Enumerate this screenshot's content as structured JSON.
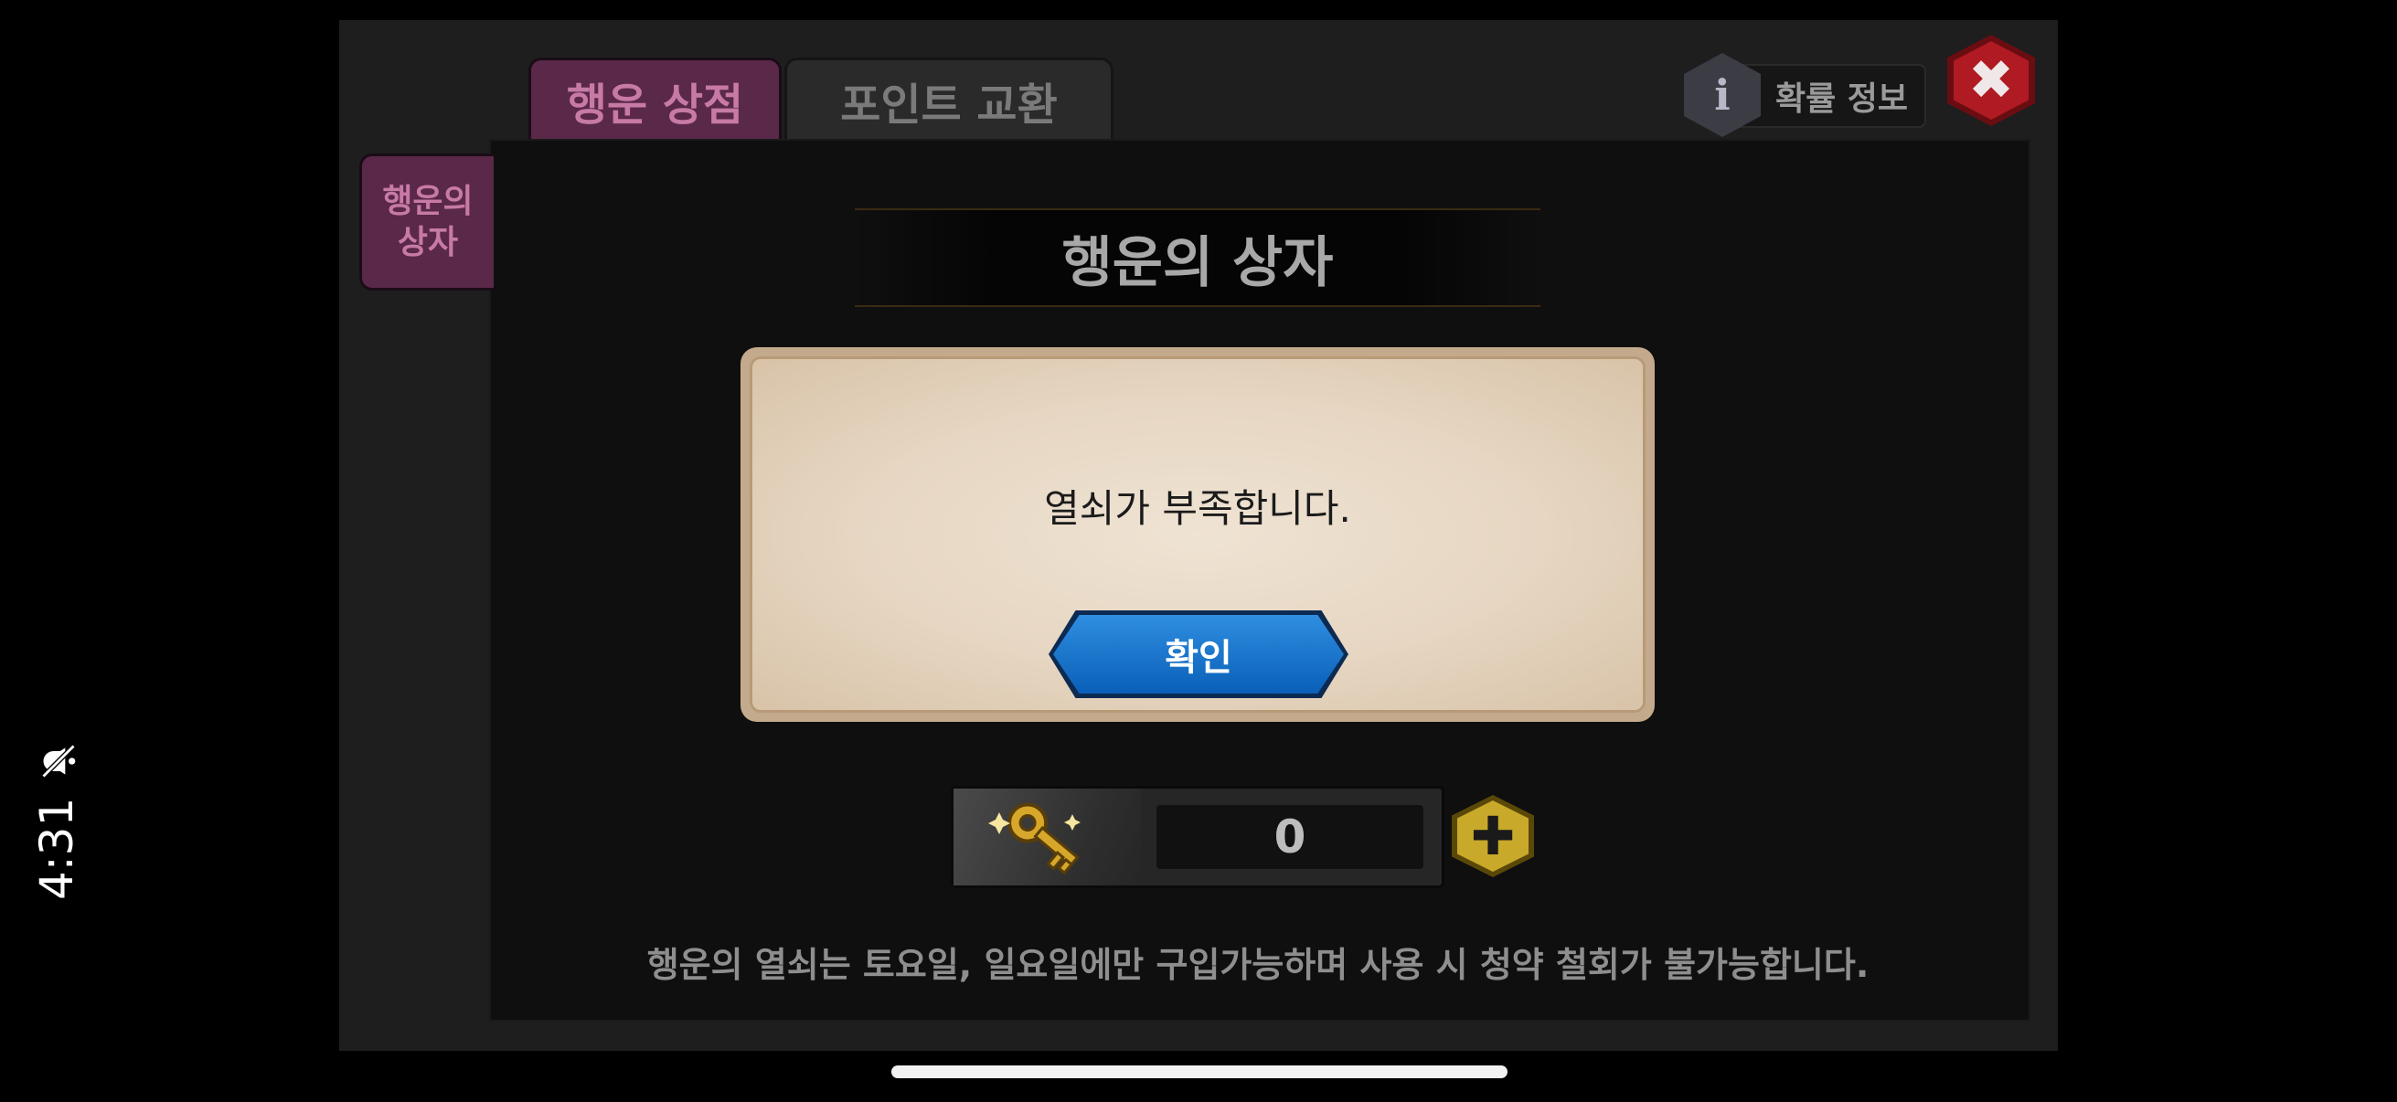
{
  "status_bar": {
    "time": "4:31",
    "silent_icon": "bell-slash-icon"
  },
  "tabs": [
    {
      "label": "행운 상점",
      "active": true
    },
    {
      "label": "포인트 교환",
      "active": false
    }
  ],
  "side_tab": {
    "label": "행운의\n상자"
  },
  "header": {
    "info_icon": "i",
    "info_label": "확률 정보",
    "close_icon": "close-icon"
  },
  "section_title": "행운의 상자",
  "dialog": {
    "message": "열쇠가 부족합니다.",
    "confirm_label": "확인"
  },
  "key_counter": {
    "icon": "golden-key-icon",
    "count": "0",
    "add_icon": "plus-icon"
  },
  "notice": "행운의 열쇠는 토요일, 일요일에만 구입가능하며 사용 시 청약 철회가 불가능합니다.",
  "colors": {
    "active_tab": "#5a2848",
    "confirm_button": "#0a5fb8",
    "close_button": "#b01a22",
    "plus_button": "#c9a92a"
  }
}
